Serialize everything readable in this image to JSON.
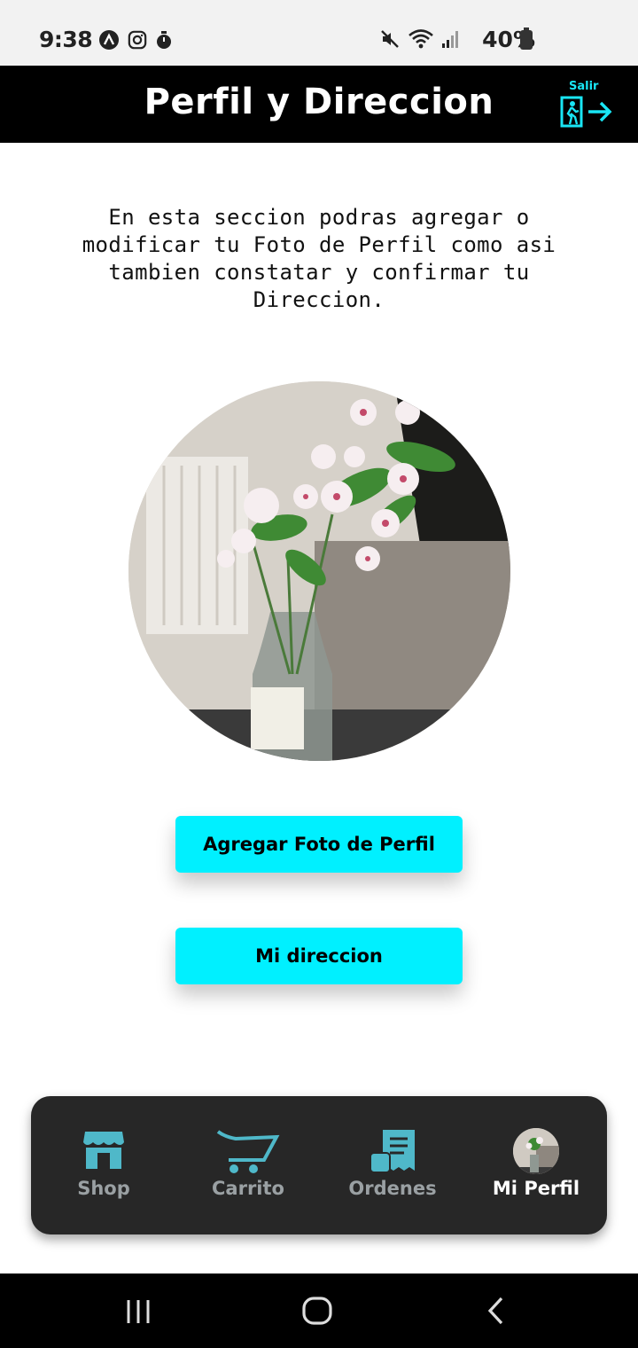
{
  "status_bar": {
    "time": "9:38",
    "battery": "40%"
  },
  "header": {
    "title": "Perfil y Direccion",
    "logout_label": "Salir"
  },
  "main": {
    "description": "En esta seccion podras agregar o modificar tu Foto de Perfil como asi tambien constatar y confirmar tu Direccion.",
    "add_photo_button": "Agregar Foto de Perfil",
    "address_button": "Mi direccion"
  },
  "bottom_nav": {
    "items": [
      {
        "label": "Shop",
        "icon": "store-icon"
      },
      {
        "label": "Carrito",
        "icon": "cart-icon"
      },
      {
        "label": "Ordenes",
        "icon": "receipt-icon"
      },
      {
        "label": "Mi Perfil",
        "icon": "avatar"
      }
    ],
    "active": "Mi Perfil"
  },
  "colors": {
    "accent": "#00f0ff",
    "nav_icon": "#4fb8c9",
    "header_bg": "#000000",
    "nav_bg": "#272727"
  }
}
